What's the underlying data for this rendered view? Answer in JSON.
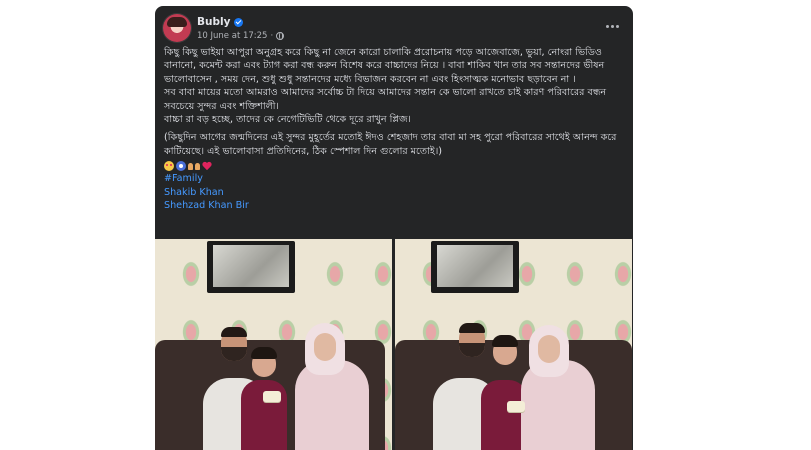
{
  "post": {
    "author": "Bubly",
    "date": "10 June at 17:25",
    "verified": true,
    "audience_icon": "globe-icon",
    "menu_icon": "more-horizontal-icon",
    "paragraphs": [
      "কিছু কিছু ভাইয়া আপুরা অনুগ্রহ করে কিছু না জেনে কারো চালাকি প্ররোচনায় পড়ে আজেবাজে, ভুয়া, নোংরা ভিডিও বানানো, কমেন্ট করা এবং ট্যাগ করা বন্ধ করুন বিশেষ করে বাচ্চাদের নিয়ে । বাবা শাকিব খান তার সব সন্তানদের ভীষন ভালোবাসেন , সময় দেন, শুধু শুধু সন্তানদের মধ্যে বিভাজন করবেন না এবং হিংসাত্মক মনোভাব ছড়াবেন না ।",
      "সব বাবা মায়ের মতো আমরাও আমাদের সর্বোচ্চ টা দিয়ে আমাদের সন্তান কে ভালো রাখতে চাই কারণ পরিবারের বন্ধন সবচেয়ে সুন্দর এবং শক্তিশালী।",
      "বাচ্চা রা বড় হচ্ছে, তাদের কে নেগেটিভিটি থেকে দূরে রাখুন প্লিজ।",
      "(কিছুদিন আগের জন্মদিনের এই সুন্দর মুহূর্তের মতোই ঈদও শেহজাদ তার বাবা মা সহ পুরো পরিবারের সাথেই আনন্দ করে কাটিয়েছে। এই ভালোবাসা প্রতিদিনের, ঠিক স্পেশাল দিন গুলোর মতোই।)"
    ],
    "emoji_names": [
      "smiling-face-with-hearts-icon",
      "evil-eye-icon",
      "raising-hands-icon",
      "heart-icon"
    ],
    "hashtag": "#Family",
    "tags": [
      "Shakib Khan",
      "Shehzad Khan Bir"
    ],
    "photos": [
      {
        "alt": "family-photo-1"
      },
      {
        "alt": "family-photo-2"
      }
    ]
  }
}
